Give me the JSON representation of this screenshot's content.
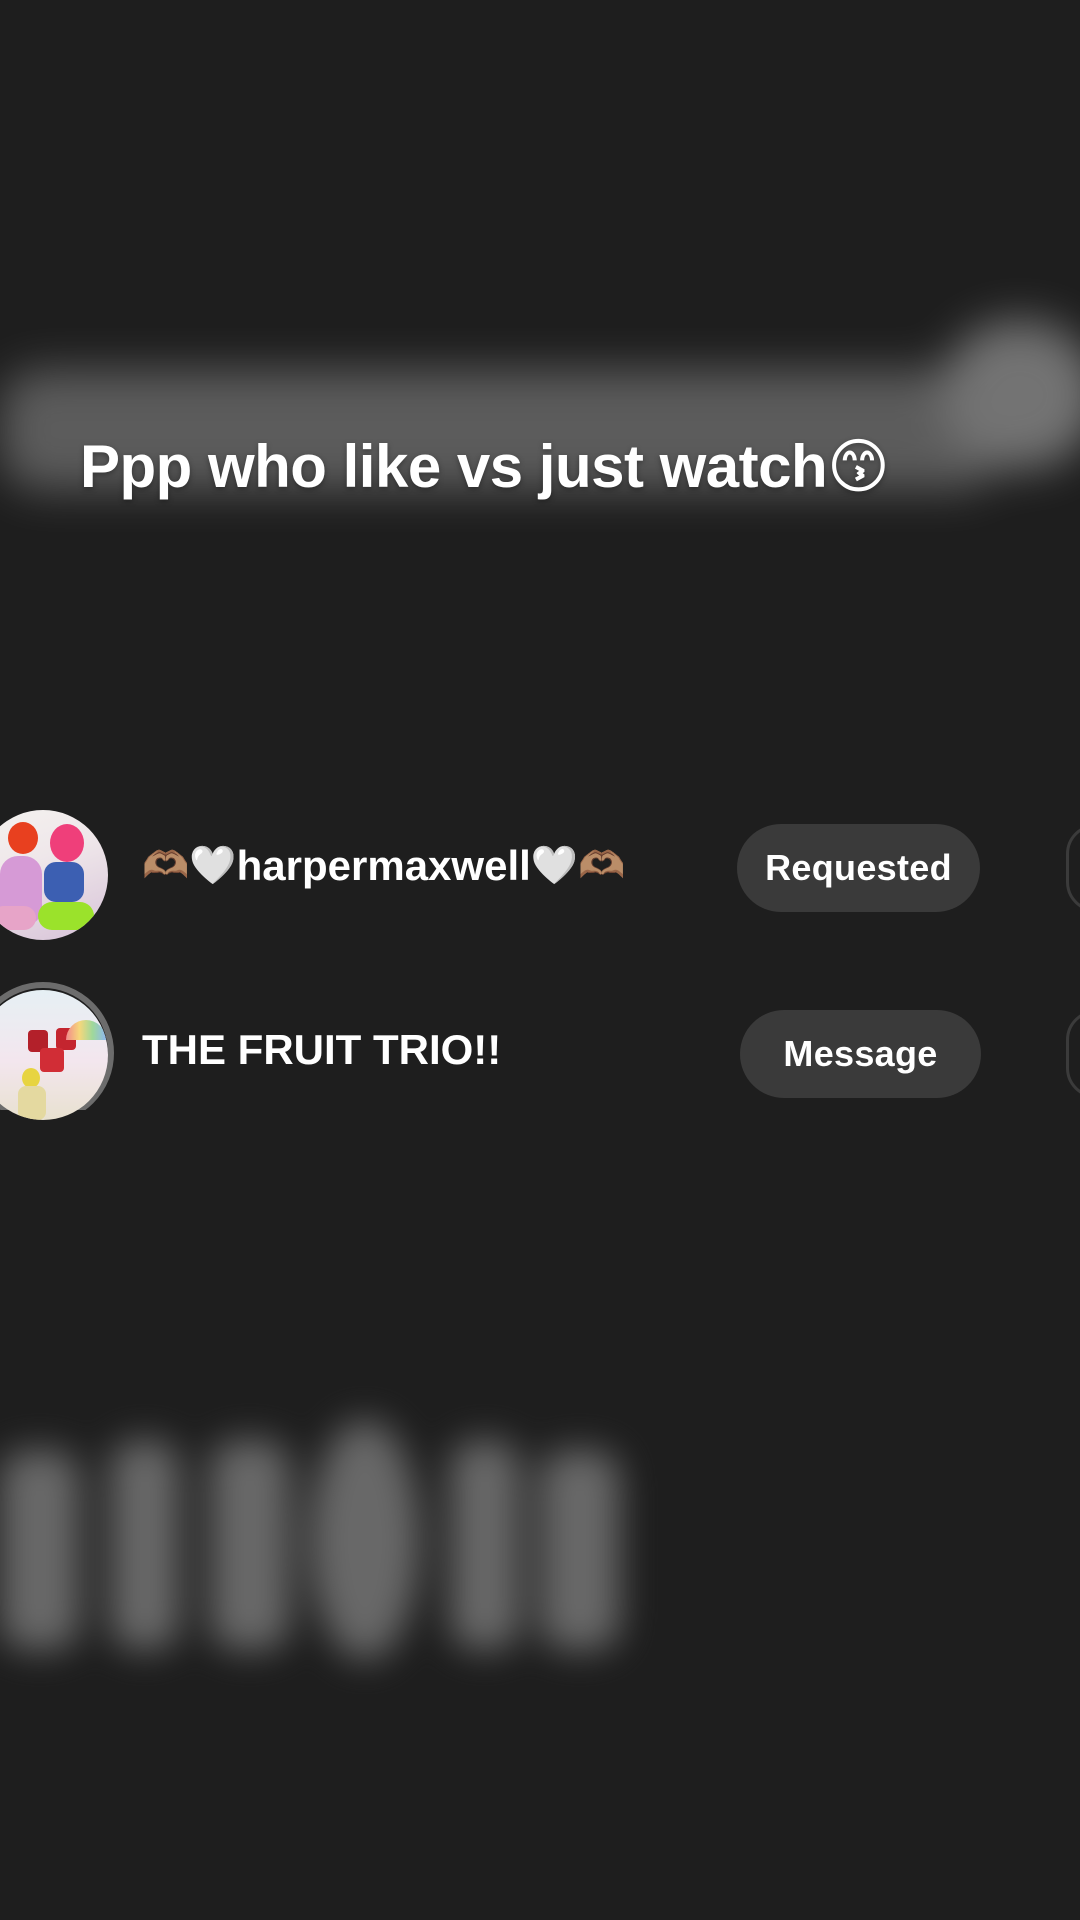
{
  "caption": {
    "text": "Ppp who like vs just watch",
    "emoji": "😙"
  },
  "accounts": [
    {
      "username": "harpermaxwell",
      "prefix_emoji": "🫶🏽🤍",
      "suffix_emoji": "🤍🫶🏽",
      "button_label": "Requested"
    },
    {
      "username": "THE FRUIT TRIO!!",
      "button_label": "Message"
    }
  ],
  "colors": {
    "background": "#1e1e1e",
    "pill": "#3a3a3a",
    "text": "#ffffff"
  }
}
